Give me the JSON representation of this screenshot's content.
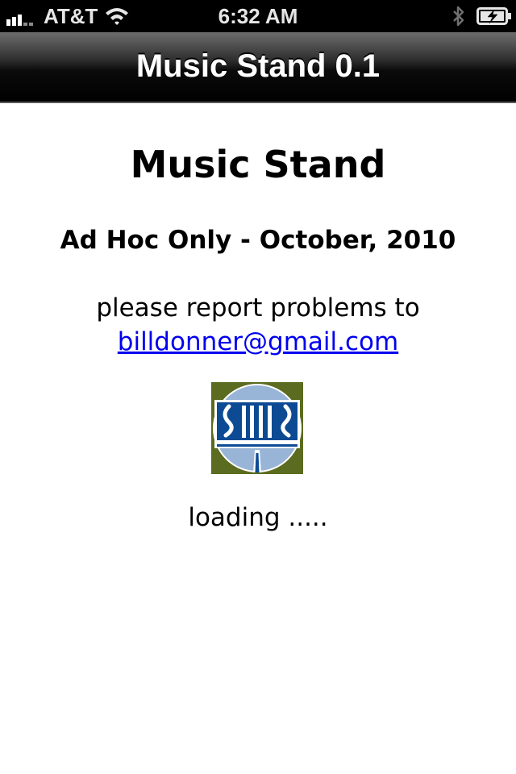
{
  "status_bar": {
    "carrier": "AT&T",
    "time": "6:32 AM"
  },
  "nav_bar": {
    "title": "Music Stand 0.1"
  },
  "content": {
    "heading": "Music Stand",
    "subheading": "Ad Hoc Only - October, 2010",
    "report_text": "please report problems to",
    "email": "billdonner@gmail.com",
    "loading_text": "loading ....."
  },
  "colors": {
    "link": "#0000ee",
    "logo_background": "#5b6b1f",
    "logo_circle": "#98b4d6",
    "logo_blue": "#0d4a94"
  },
  "icons": [
    "signal-icon",
    "wifi-icon",
    "bluetooth-icon",
    "battery-icon",
    "music-stand-logo"
  ]
}
